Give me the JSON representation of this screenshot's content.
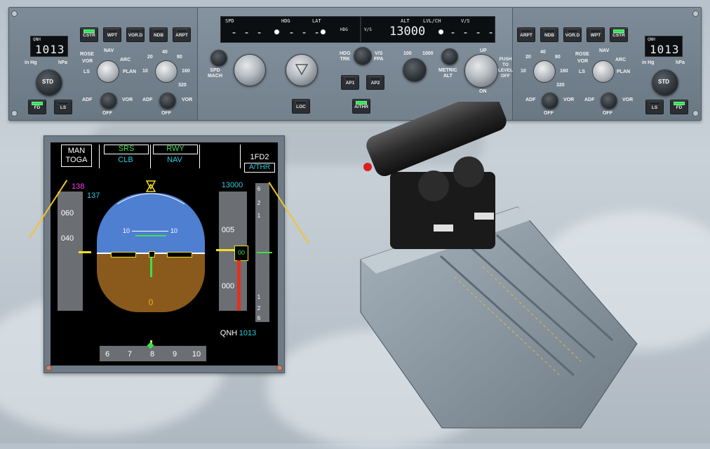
{
  "fcu": {
    "left_efis": {
      "qnh_label": "QNH",
      "qnh_value": "1013",
      "unit_inhg": "in Hg",
      "unit_hpa": "hPa",
      "std_label": "STD",
      "buttons": [
        "CSTR",
        "WPT",
        "VOR.D",
        "NDB",
        "ARPT"
      ],
      "mode_labels": [
        "NAV",
        "ROSE",
        "ARC",
        "VOR",
        "LS",
        "PLAN"
      ],
      "range_labels": [
        "20",
        "40",
        "80",
        "10",
        "160",
        "320"
      ],
      "adf_label": "ADF",
      "vor_label": "VOR",
      "off_label": "OFF",
      "fd_label": "FD",
      "ls_label": "LS"
    },
    "center": {
      "spd_label": "SPD",
      "spd_value": "- - -",
      "hdg_label": "HDG",
      "hdg_value": "- - -",
      "lat_label": "LAT",
      "hdg_vs_label": "HDG",
      "vs_label": "V/S",
      "alt_label": "ALT",
      "lvlch_label": "LVL/CH",
      "vs_label_right": "V/S",
      "alt_value": "13000",
      "vs_value": "- - - -",
      "spd_mach_label": "SPD\nMACH",
      "hdg_trk_label": "HDG\nTRK",
      "vs_fpa_label": "V/S\nFPA",
      "ap1_label": "AP1",
      "ap2_label": "AP2",
      "athr_label": "A/THR",
      "loc_label": "LOC",
      "alt_100": "100",
      "alt_1000": "1000",
      "metric_alt_label": "METRIC\nALT",
      "up_label": "UP",
      "on_label": "ON",
      "push_label": "PUSH\nTO\nLEVEL\nOFF"
    },
    "right_efis": {
      "qnh_label": "QNH",
      "qnh_value": "1013",
      "unit_inhg": "in Hg",
      "unit_hpa": "hPa",
      "std_label": "STD",
      "buttons": [
        "ARPT",
        "NDB",
        "VOR.D",
        "WPT",
        "CSTR"
      ],
      "fd_label": "FD",
      "ls_label": "LS"
    }
  },
  "pfd": {
    "fma": {
      "col1_line1": "MAN",
      "col1_line2": "TOGA",
      "col2_line1": "SRS",
      "col2_line2": "CLB",
      "col3_line1": "RWY",
      "col3_line2": "NAV",
      "col5_line1": "1FD2",
      "col5_line2": "A/THR"
    },
    "speed": {
      "target": "138",
      "current": "137",
      "ticks": [
        "060",
        "040"
      ]
    },
    "attitude": {
      "pitch_labels": [
        "10",
        "10"
      ],
      "heading_readout": "0"
    },
    "altitude": {
      "selected": "13000",
      "ticks": [
        "005",
        "000"
      ],
      "readout": "00",
      "qnh_label": "QNH",
      "qnh_value": "1013"
    },
    "vsi_ticks": [
      "6",
      "2",
      "1",
      "1",
      "2",
      "6"
    ],
    "heading_scale": [
      "6",
      "7",
      "8",
      "9",
      "10"
    ]
  },
  "colors": {
    "fma_green": "#3ce04a",
    "fma_cyan": "#2ecbe0",
    "speed_magenta": "#ff3df0",
    "annotation_yellow": "#f2c42a",
    "sky": "#4f7fd1",
    "ground": "#8a5a1c"
  }
}
